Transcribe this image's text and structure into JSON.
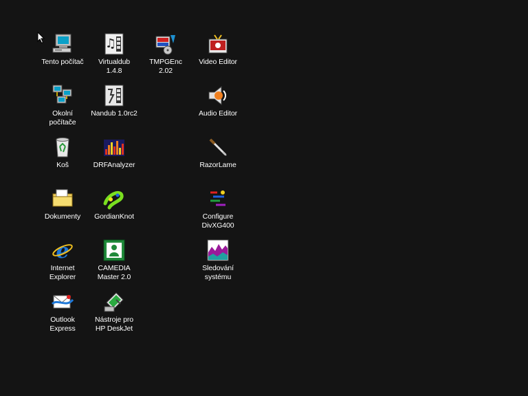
{
  "desktop": {
    "icons": {
      "my_computer": {
        "label": "Tento počítač",
        "icon": "computer-icon"
      },
      "virtualdub": {
        "label": "Virtualdub\n1.4.8",
        "icon": "virtualdub-icon"
      },
      "tmpgenc": {
        "label": "TMPGEnc\n2.02",
        "icon": "tmpgenc-icon"
      },
      "video_editor": {
        "label": "Video Editor",
        "icon": "video-editor-icon"
      },
      "network": {
        "label": "Okolní\npočítače",
        "icon": "network-icon"
      },
      "nandub": {
        "label": "Nandub 1.0rc2",
        "icon": "nandub-icon"
      },
      "audio_editor": {
        "label": "Audio Editor",
        "icon": "audio-editor-icon"
      },
      "recycle_bin": {
        "label": "Koš",
        "icon": "recycle-bin-icon"
      },
      "drfanalyzer": {
        "label": "DRFAnalyzer",
        "icon": "analyzer-icon"
      },
      "razorlame": {
        "label": "RazorLame",
        "icon": "razor-icon"
      },
      "documents": {
        "label": "Dokumenty",
        "icon": "folder-icon"
      },
      "gordianknot": {
        "label": "GordianKnot",
        "icon": "gordianknot-icon"
      },
      "configure_divx": {
        "label": "Configure\nDivXG400",
        "icon": "divx-config-icon"
      },
      "internet_explorer": {
        "label": "Internet\nExplorer",
        "icon": "internet-explorer-icon"
      },
      "camedia": {
        "label": "CAMEDIA\nMaster 2.0",
        "icon": "camedia-icon"
      },
      "system_monitor": {
        "label": "Sledování\nsystému",
        "icon": "system-monitor-icon"
      },
      "outlook_express": {
        "label": "Outlook\nExpress",
        "icon": "outlook-express-icon"
      },
      "hp_deskjet": {
        "label": "Nástroje pro\nHP DeskJet",
        "icon": "printer-tools-icon"
      }
    }
  },
  "colors": {
    "background": "#141414",
    "label_text": "#ffffff"
  }
}
